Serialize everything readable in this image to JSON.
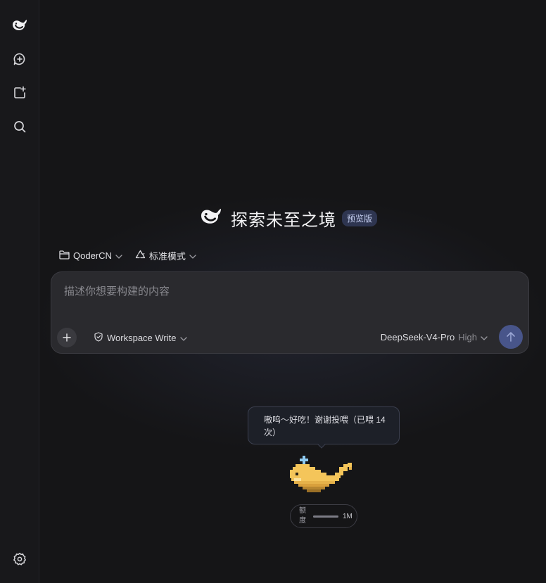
{
  "hero": {
    "title": "探索未至之境",
    "badge": "预览版"
  },
  "selectors": {
    "project": "QoderCN",
    "mode": "标准模式"
  },
  "composer": {
    "placeholder": "描述你想要构建的内容",
    "permission": "Workspace Write",
    "model": "DeepSeek-V4-Pro",
    "effort": "High"
  },
  "pet": {
    "speech": "嗷呜～好吃！谢谢投喂（已喂 14 次）"
  },
  "quota": {
    "label": "额度",
    "value": "1M",
    "fraction": 1.0
  },
  "icons": {
    "sidebar_logo": "whale-logo-icon",
    "new_chat": "new-chat-icon",
    "new_project": "new-project-icon",
    "search": "search-icon",
    "settings": "gear-icon",
    "folder": "folder-icon",
    "mode": "recycle-icon",
    "shield": "shield-icon",
    "send": "arrow-up-icon"
  },
  "colors": {
    "accent": "#48558a",
    "badge_bg": "#2e3550",
    "pet": "#f4c55a"
  }
}
